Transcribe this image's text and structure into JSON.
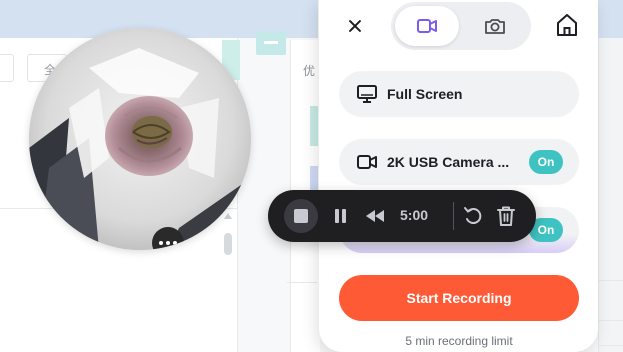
{
  "background_app": {
    "input_hint": "全",
    "column_header": "优"
  },
  "webcam": {
    "more_icon": "ellipsis-icon"
  },
  "panel": {
    "close_icon": "close-icon",
    "modes": [
      {
        "name": "video",
        "icon": "video-camera-icon",
        "selected": true
      },
      {
        "name": "photo",
        "icon": "camera-icon",
        "selected": false
      }
    ],
    "home_icon": "home-icon",
    "options": [
      {
        "label": "Full Screen",
        "icon": "monitor-icon"
      },
      {
        "label": "2K USB Camera ...",
        "icon": "video-camera-icon",
        "toggle": "On"
      },
      {
        "label": "",
        "icon": "microphone-icon",
        "toggle": "On"
      }
    ],
    "start_button": "Start Recording",
    "limit_note": "5 min recording limit",
    "accent_color": "#ff5a36",
    "toggle_color": "#3fc3c2",
    "selected_mode_color": "#7b5cf0"
  },
  "control_bar": {
    "stop_icon": "stop-icon",
    "pause_icon": "pause-icon",
    "rewind_icon": "rewind-icon",
    "timer": "5:00",
    "restart_icon": "restart-icon",
    "trash_icon": "trash-icon"
  }
}
